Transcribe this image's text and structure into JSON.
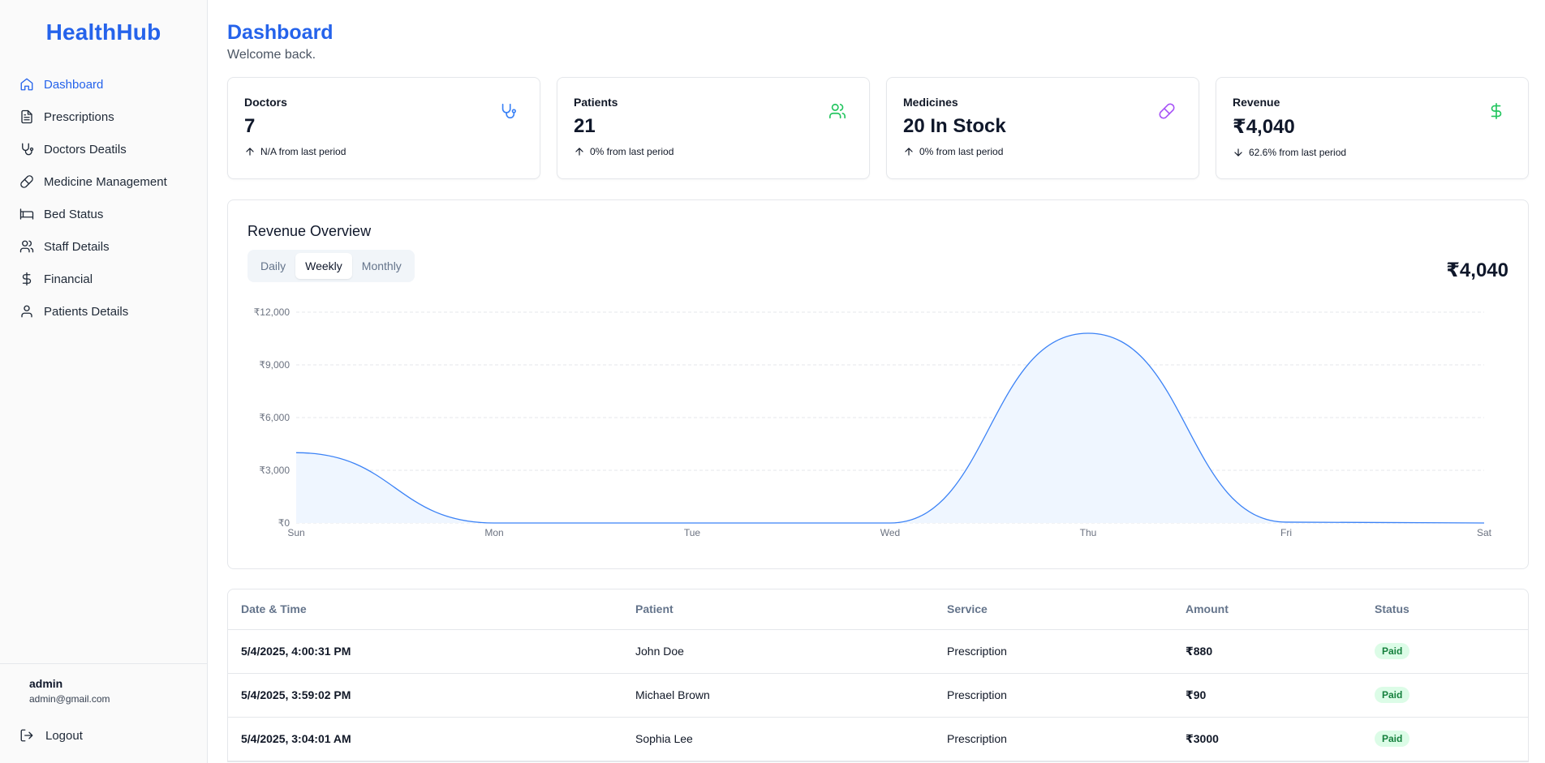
{
  "brand": "HealthHub",
  "sidebar": {
    "items": [
      {
        "label": "Dashboard",
        "icon": "home-icon",
        "active": true
      },
      {
        "label": "Prescriptions",
        "icon": "file-text-icon"
      },
      {
        "label": "Doctors Deatils",
        "icon": "stethoscope-icon"
      },
      {
        "label": "Medicine Management",
        "icon": "pill-icon"
      },
      {
        "label": "Bed Status",
        "icon": "bed-icon"
      },
      {
        "label": "Staff Details",
        "icon": "users-icon"
      },
      {
        "label": "Financial",
        "icon": "dollar-icon"
      },
      {
        "label": "Patients Details",
        "icon": "user-icon"
      }
    ],
    "user": {
      "name": "admin",
      "email": "admin@gmail.com"
    },
    "logout_label": "Logout"
  },
  "header": {
    "title": "Dashboard",
    "subtitle": "Welcome back."
  },
  "cards": [
    {
      "label": "Doctors",
      "value": "7",
      "delta": "N/A from last period",
      "trend": "up",
      "icon": "stethoscope-icon",
      "color": "#3b82f6"
    },
    {
      "label": "Patients",
      "value": "21",
      "delta": "0% from last period",
      "trend": "up",
      "icon": "users-icon",
      "color": "#22c55e"
    },
    {
      "label": "Medicines",
      "value": "20 In Stock",
      "delta": "0% from last period",
      "trend": "up",
      "icon": "pill-icon",
      "color": "#a855f7"
    },
    {
      "label": "Revenue",
      "value": "₹4,040",
      "delta": "62.6% from last period",
      "trend": "down",
      "icon": "dollar-icon",
      "color": "#22c55e"
    }
  ],
  "revenue": {
    "title": "Revenue Overview",
    "tabs": [
      "Daily",
      "Weekly",
      "Monthly"
    ],
    "active_tab": "Weekly",
    "total": "₹4,040"
  },
  "chart_data": {
    "type": "area",
    "categories": [
      "Sun",
      "Mon",
      "Tue",
      "Wed",
      "Thu",
      "Fri",
      "Sat"
    ],
    "values": [
      4000,
      0,
      0,
      0,
      10800,
      50,
      0
    ],
    "ylim": [
      0,
      12000
    ],
    "yticks": [
      "₹0",
      "₹3,000",
      "₹6,000",
      "₹9,000",
      "₹12,000"
    ],
    "ytick_values": [
      0,
      3000,
      6000,
      9000,
      12000
    ],
    "grid": true,
    "line_color": "#3b82f6",
    "fill_color": "#eff6ff"
  },
  "table": {
    "headers": [
      "Date & Time",
      "Patient",
      "Service",
      "Amount",
      "Status"
    ],
    "rows": [
      [
        "5/4/2025, 4:00:31 PM",
        "John Doe",
        "Prescription",
        "₹880",
        "Paid"
      ],
      [
        "5/4/2025, 3:59:02 PM",
        "Michael Brown",
        "Prescription",
        "₹90",
        "Paid"
      ],
      [
        "5/4/2025, 3:04:01 AM",
        "Sophia Lee",
        "Prescription",
        "₹3000",
        "Paid"
      ]
    ]
  }
}
